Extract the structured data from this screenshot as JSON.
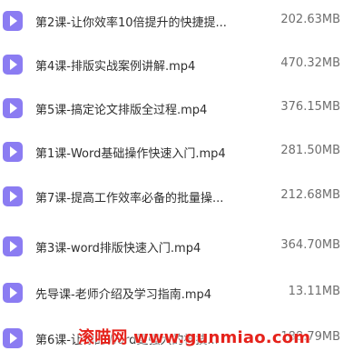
{
  "files": [
    {
      "name": "第2课-让你效率10倍提升的快捷提...",
      "size": "202.63MB",
      "icon": "video-file-icon"
    },
    {
      "name": "第4课-排版实战案例讲解.mp4",
      "size": "470.32MB",
      "icon": "video-file-icon"
    },
    {
      "name": "第5课-搞定论文排版全过程.mp4",
      "size": "376.15MB",
      "icon": "video-file-icon"
    },
    {
      "name": "第1课-Word基础操作快速入门.mp4",
      "size": "281.50MB",
      "icon": "video-file-icon"
    },
    {
      "name": "第7课-提高工作效率必备的批量操...",
      "size": "212.68MB",
      "icon": "video-file-icon"
    },
    {
      "name": "第3课-word排版快速入门.mp4",
      "size": "364.70MB",
      "icon": "video-file-icon"
    },
    {
      "name": "先导课-老师介绍及学习指南.mp4",
      "size": "13.11MB",
      "icon": "video-file-icon"
    },
    {
      "name": "第6课-让你的Word更强大的神技...",
      "size": "188.79MB",
      "icon": "video-file-icon"
    }
  ],
  "watermark": "滚喵网 www.gunmiao.com",
  "colors": {
    "icon": "#8b7cf2",
    "watermark": "#e5221b"
  }
}
